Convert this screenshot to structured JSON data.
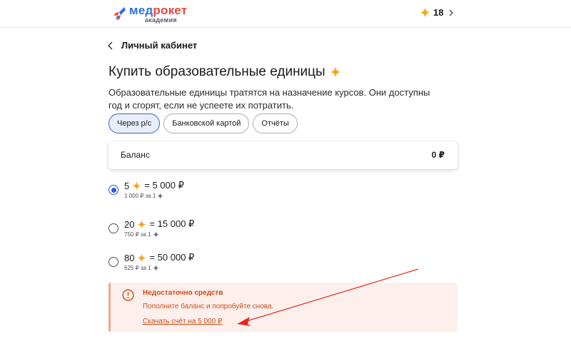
{
  "header": {
    "logo_brand_main": "мед",
    "logo_brand_accent": "рокет",
    "logo_sub": "академия",
    "units_count": "18"
  },
  "back": {
    "label": "Личный кабинет"
  },
  "page": {
    "title": "Купить образовательные единицы",
    "description": "Образовательные единицы тратятся на назначение курсов. Они доступны год и сгорят, если не успеете их потратить."
  },
  "tabs": [
    {
      "label": "Через р/с",
      "active": true
    },
    {
      "label": "Банковской картой",
      "active": false
    },
    {
      "label": "Отчёты",
      "active": false
    }
  ],
  "balance": {
    "label": "Баланс",
    "value": "0 ₽"
  },
  "options": [
    {
      "qty": "5",
      "price": "= 5 000 ₽",
      "per_unit": "1 000 ₽ за 1",
      "selected": true
    },
    {
      "qty": "20",
      "price": "= 15 000 ₽",
      "per_unit": "750 ₽ за 1",
      "selected": false
    },
    {
      "qty": "80",
      "price": "= 50 000 ₽",
      "per_unit": "625 ₽ за 1",
      "selected": false
    }
  ],
  "alert": {
    "title": "Недостаточно средств",
    "text": "Пополните баланс и попробуйте снова.",
    "link": "Скачать счёт на 5 000 ₽"
  },
  "colors": {
    "accent": "#2b5fd9",
    "star": "#f5a623",
    "alert_text": "#cc4b1a",
    "alert_bg": "#fdf0ec",
    "annotation_arrow": "#e8261e"
  },
  "icons": [
    "rocket-logo-icon",
    "star-icon",
    "chevron-right-icon",
    "chevron-left-icon",
    "exclamation-circle-icon"
  ]
}
